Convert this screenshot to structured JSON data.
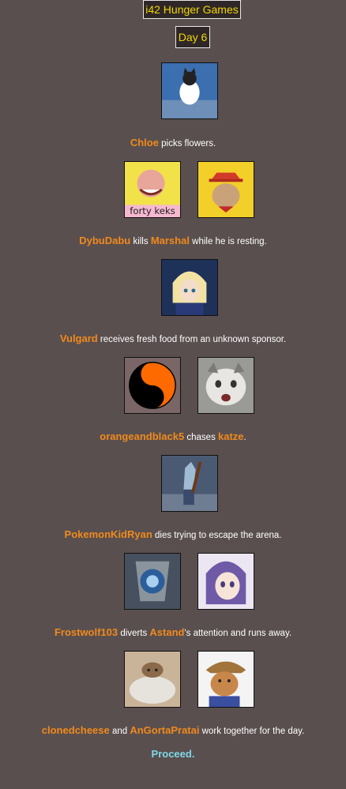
{
  "header": {
    "title": "i42 Hunger Games",
    "day": "Day 6"
  },
  "events": [
    {
      "p1": "Chloe",
      "text": " picks flowers."
    },
    {
      "p1": "DybuDabu",
      "mid": " kills ",
      "p2": "Marshal",
      "text": " while he is resting.",
      "avatar1_caption": "forty keks"
    },
    {
      "p1": "Vulgard",
      "text": " receives fresh food from an unknown sponsor."
    },
    {
      "p1": "orangeandblack5",
      "mid": " chases ",
      "p2": "katze",
      "text": "."
    },
    {
      "p1": "PokemonKidRyan",
      "text": " dies trying to escape the arena."
    },
    {
      "p1": "Frostwolf103",
      "mid": " diverts ",
      "p2": "Astand",
      "text": "'s attention and runs away."
    },
    {
      "p1": "clonedcheese",
      "mid": " and ",
      "p2": "AnGortaPratai",
      "text": " work together for the day."
    }
  ],
  "proceed": "Proceed.",
  "colors": {
    "name": "#f08a1c",
    "title": "#f0d700",
    "proceed": "#7fd9e8",
    "background": "#5a4f4f"
  }
}
